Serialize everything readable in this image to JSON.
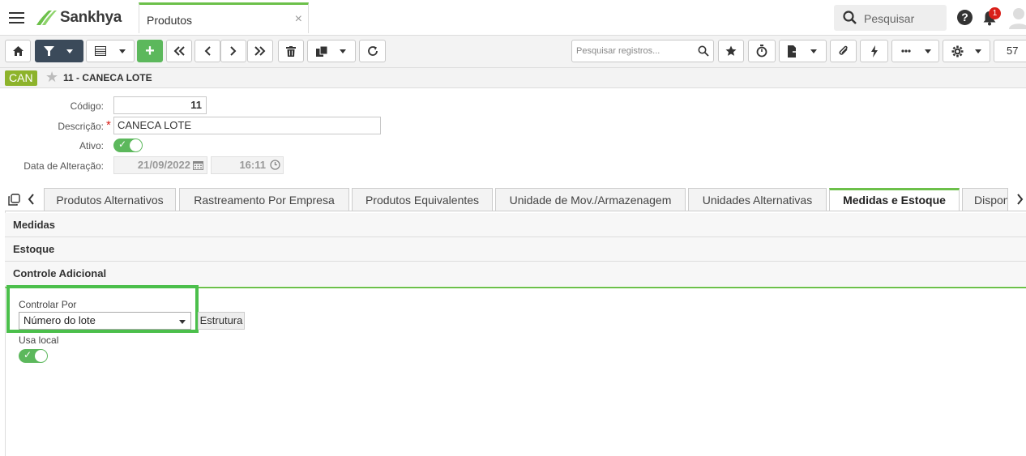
{
  "topbar": {
    "brand": "Sankhya",
    "app_tab": "Produtos",
    "app_tab_close": "×",
    "search_label": "Pesquisar",
    "help": "?",
    "notifications": "1"
  },
  "toolbar": {
    "search_placeholder": "Pesquisar registros...",
    "page_number": "57"
  },
  "record": {
    "badge": "CAN",
    "title": "11 - CANECA LOTE"
  },
  "form": {
    "codigo_label": "Código:",
    "codigo_value": "11",
    "descricao_label": "Descrição:",
    "descricao_value": "CANECA LOTE",
    "ativo_label": "Ativo:",
    "ativo_on": true,
    "data_label": "Data de Alteração:",
    "data_value": "21/09/2022",
    "hora_value": "16:11",
    "required_mark": "*"
  },
  "tabs": [
    {
      "label": "Produtos Alternativos"
    },
    {
      "label": "Rastreamento Por Empresa"
    },
    {
      "label": "Produtos Equivalentes"
    },
    {
      "label": "Unidade de Mov./Armazenagem"
    },
    {
      "label": "Unidades Alternativas"
    },
    {
      "label": "Medidas e Estoque",
      "active": true
    },
    {
      "label": "Disponibilidade"
    }
  ],
  "sections": {
    "medidas": "Medidas",
    "estoque": "Estoque",
    "controle": "Controle Adicional"
  },
  "controle": {
    "controlar_por_label": "Controlar Por",
    "controlar_por_value": "Número do lote",
    "estrutura_button": "Estrutura",
    "usa_local_label": "Usa local",
    "usa_local_on": true
  },
  "colors": {
    "accent_green": "#6cc04a",
    "toggle_green": "#5cb85c",
    "badge_olive": "#8db32b",
    "highlight_green": "#4bbf4b",
    "dark_button": "#3b4a5a",
    "notification_red": "#d9201a"
  }
}
